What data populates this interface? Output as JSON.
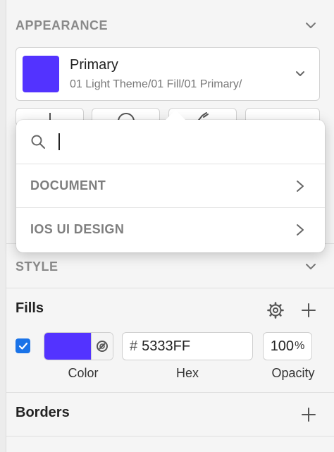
{
  "appearance": {
    "title": "APPEARANCE",
    "style_name": "Primary",
    "style_path": "01 Light Theme/01 Fill/01 Primary/",
    "swatch_color": "#5333FF"
  },
  "popover": {
    "search_value": "",
    "items": [
      {
        "label": "DOCUMENT"
      },
      {
        "label": "IOS UI DESIGN"
      }
    ]
  },
  "style_section": {
    "title": "STYLE"
  },
  "fills": {
    "title": "Fills",
    "enabled": true,
    "color": "#5333FF",
    "hex_prefix": "#",
    "hex": "5333FF",
    "opacity": "100",
    "opacity_unit": "%",
    "labels": {
      "color": "Color",
      "hex": "Hex",
      "opacity": "Opacity"
    }
  },
  "borders": {
    "title": "Borders"
  },
  "colors": {
    "accent": "#1a73e8",
    "muted_header": "#8a8a8a"
  }
}
